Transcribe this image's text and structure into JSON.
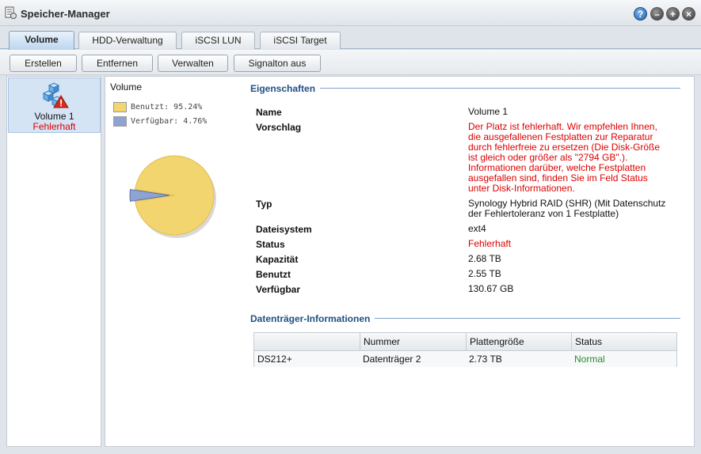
{
  "window": {
    "title": "Speicher-Manager"
  },
  "tabs": [
    {
      "label": "Volume",
      "active": true
    },
    {
      "label": "HDD-Verwaltung",
      "active": false
    },
    {
      "label": "iSCSI LUN",
      "active": false
    },
    {
      "label": "iSCSI Target",
      "active": false
    }
  ],
  "toolbar": {
    "create": "Erstellen",
    "remove": "Entfernen",
    "manage": "Verwalten",
    "beep_off": "Signalton aus"
  },
  "volume_list": [
    {
      "name": "Volume 1",
      "status": "Fehlerhaft",
      "status_color": "#dd0000"
    }
  ],
  "usage": {
    "title": "Volume",
    "used_label": "Benutzt: 95.24%",
    "free_label": "Verfügbar: 4.76%",
    "used_color": "#f2d56e",
    "free_color": "#8ea3d4"
  },
  "chart_data": {
    "type": "pie",
    "title": "Volume",
    "slices": [
      {
        "label": "Benutzt",
        "value": 95.24,
        "color": "#f2d56e"
      },
      {
        "label": "Verfügbar",
        "value": 4.76,
        "color": "#8ea3d4"
      }
    ]
  },
  "properties": {
    "section_title": "Eigenschaften",
    "name_label": "Name",
    "name_value": "Volume 1",
    "suggestion_label": "Vorschlag",
    "suggestion_lines": [
      "Der Platz ist fehlerhaft. Wir empfehlen Ihnen,",
      "die ausgefallenen Festplatten zur Reparatur",
      "durch fehlerfreie zu ersetzen (Die Disk-Größe",
      "ist gleich oder größer als \"2794 GB\".).",
      "Informationen darüber, welche Festplatten",
      "ausgefallen sind, finden Sie im Feld Status",
      "unter Disk-Informationen."
    ],
    "type_label": "Typ",
    "type_lines": [
      "Synology Hybrid RAID (SHR) (Mit Datenschutz",
      "der Fehlertoleranz von 1 Festplatte)"
    ],
    "filesystem_label": "Dateisystem",
    "filesystem_value": "ext4",
    "status_label": "Status",
    "status_value": "Fehlerhaft",
    "capacity_label": "Kapazität",
    "capacity_value": "2.68 TB",
    "used_label": "Benutzt",
    "used_value": "2.55 TB",
    "available_label": "Verfügbar",
    "available_value": "130.67 GB"
  },
  "disks": {
    "section_title": "Datenträger-Informationen",
    "columns": [
      "",
      "Nummer",
      "Plattengröße",
      "Status"
    ],
    "rows": [
      {
        "device": "DS212+",
        "number": "Datenträger 2",
        "size": "2.73 TB",
        "status": "Normal",
        "status_color": "#2d8a2d"
      }
    ]
  }
}
